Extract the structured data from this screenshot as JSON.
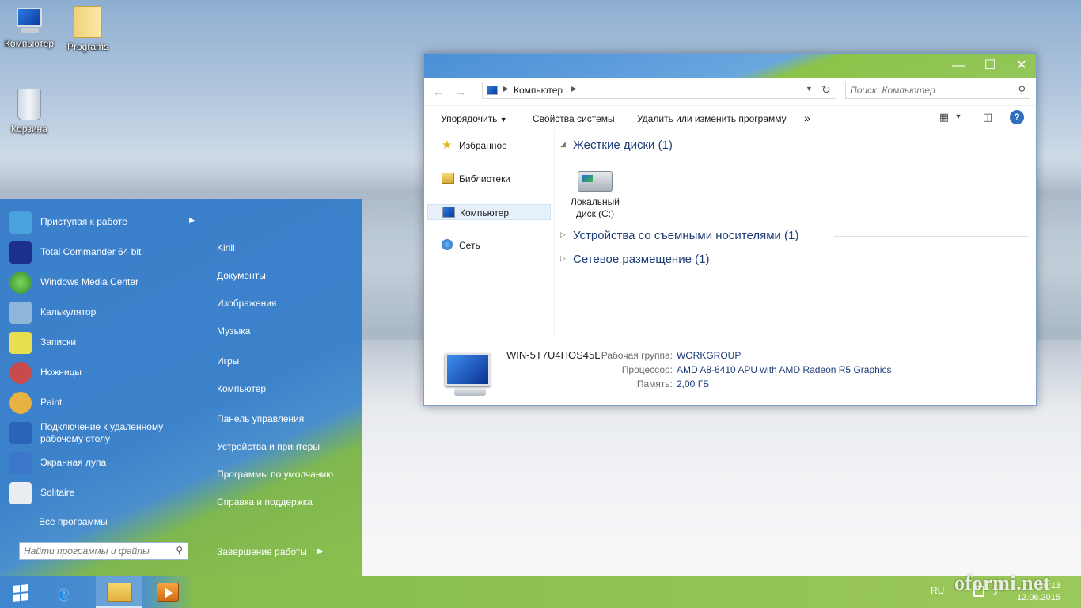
{
  "desktop": {
    "icons": [
      {
        "label": "Компьютер",
        "icon": "computer-icon"
      },
      {
        "label": "Programs",
        "icon": "folder-icon"
      },
      {
        "label": "Корзина",
        "icon": "recycle-bin-icon"
      }
    ]
  },
  "explorer": {
    "address": {
      "crumb": "Компьютер"
    },
    "search": {
      "placeholder": "Поиск: Компьютер"
    },
    "toolbar": {
      "organize": "Упорядочить",
      "system_props": "Свойства системы",
      "uninstall": "Удалить или изменить программу",
      "more": "»"
    },
    "nav": [
      {
        "label": "Избранное",
        "icon": "star-icon"
      },
      {
        "label": "Библиотеки",
        "icon": "library-icon"
      },
      {
        "label": "Компьютер",
        "icon": "computer-icon",
        "selected": true
      },
      {
        "label": "Сеть",
        "icon": "network-icon"
      }
    ],
    "groups": [
      {
        "label": "Жесткие диски (1)",
        "expanded": true
      },
      {
        "label": "Устройства со съемными носителями (1)",
        "expanded": false
      },
      {
        "label": "Сетевое размещение (1)",
        "expanded": false
      }
    ],
    "drive": {
      "label": "Локальный диск (C:)"
    },
    "details": {
      "pc_name": "WIN-5T7U4HOS45L",
      "workgroup_key": "Рабочая группа:",
      "workgroup_val": "WORKGROUP",
      "cpu_key": "Процессор:",
      "cpu_val": "AMD A8-6410 APU with AMD Radeon R5 Graphics",
      "mem_key": "Память:",
      "mem_val": "2,00 ГБ"
    }
  },
  "start_menu": {
    "programs": [
      {
        "label": "Приступая к работе",
        "has_submenu": true,
        "color": "#4aa3df"
      },
      {
        "label": "Total Commander 64 bit",
        "color": "#1c2f8a"
      },
      {
        "label": "Windows Media Center",
        "color": "#3fa13a"
      },
      {
        "label": "Калькулятор",
        "color": "#8fb6d8"
      },
      {
        "label": "Записки",
        "color": "#e7df4f"
      },
      {
        "label": "Ножницы",
        "color": "#c94a4a"
      },
      {
        "label": "Paint",
        "color": "#e7b23f"
      },
      {
        "label": "Подключение к удаленному рабочему столу",
        "color": "#2b63b8"
      },
      {
        "label": "Экранная лупа",
        "color": "#3c78c9"
      },
      {
        "label": "Solitaire",
        "color": "#e9edf2"
      }
    ],
    "all_programs": "Все программы",
    "search_placeholder": "Найти программы и файлы",
    "right": [
      "Kirill",
      "Документы",
      "Изображения",
      "Музыка",
      "Игры",
      "Компьютер",
      "Панель управления",
      "Устройства и принтеры",
      "Программы по умолчанию",
      "Справка и поддержка"
    ],
    "shutdown": "Завершение работы"
  },
  "taskbar": {
    "lang": "RU",
    "time": "20:13",
    "date": "12.06.2015",
    "watermark": "oformi.net"
  }
}
